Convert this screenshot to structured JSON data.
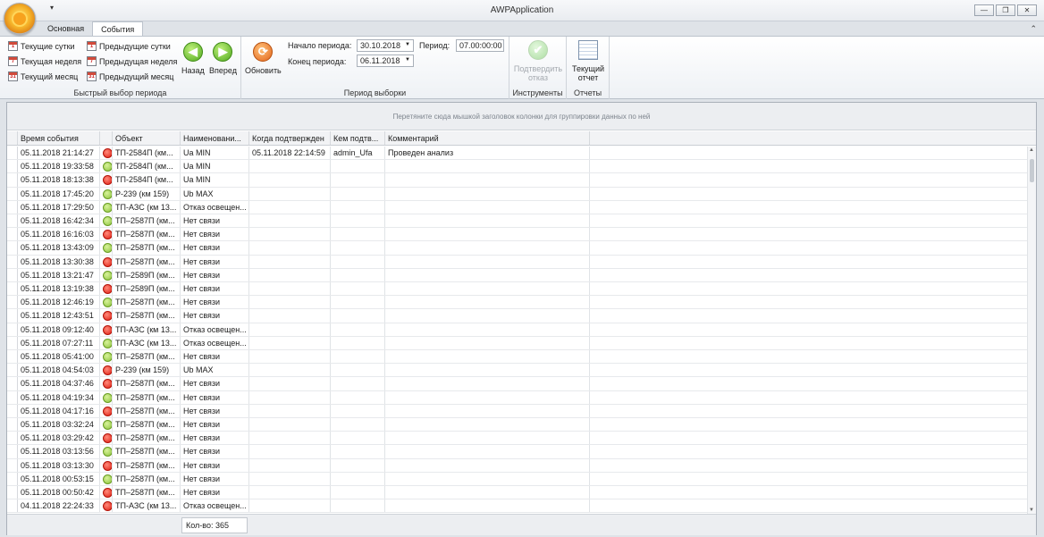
{
  "window": {
    "title": "AWPApplication",
    "qat_arrow": "▾",
    "btn_minimize": "—",
    "btn_restore": "❐",
    "btn_close": "✕",
    "collapse": "⌃"
  },
  "tabs": [
    "Основная",
    "События"
  ],
  "ribbon": {
    "quick_period": {
      "label": "Быстрый выбор периода",
      "items": [
        {
          "label": "Текущие сутки",
          "icon_text": "1"
        },
        {
          "label": "Текущая неделя",
          "icon_text": "7"
        },
        {
          "label": "Текущий месяц",
          "icon_text": "31"
        },
        {
          "label": "Предыдущие сутки",
          "icon_text": "1"
        },
        {
          "label": "Предыдущая неделя",
          "icon_text": "7"
        },
        {
          "label": "Предыдущий месяц",
          "icon_text": "31"
        }
      ],
      "back": "Назад",
      "forward": "Вперед",
      "back_glyph": "◀",
      "forward_glyph": "▶"
    },
    "period": {
      "label": "Период выборки",
      "refresh": "Обновить",
      "refresh_glyph": "⟳",
      "start_label": "Начало периода:",
      "start_value": "30.10.2018",
      "end_label": "Конец периода:",
      "end_value": "06.11.2018",
      "period_label": "Период:",
      "period_value": "07.00:00:00",
      "dd_glyph": "▼"
    },
    "tools": {
      "label": "Инструменты",
      "confirm_line1": "Подтвердить",
      "confirm_line2": "отказ",
      "confirm_glyph": "✔"
    },
    "reports": {
      "label": "Отчеты",
      "current_line1": "Текущий",
      "current_line2": "отчет"
    }
  },
  "grid": {
    "group_hint": "Перетяните сюда мышкой заголовок колонки для группировки данных по ней",
    "columns": [
      "Время события",
      "Объект",
      "Наименовани...",
      "Когда подтвержден",
      "Кем подтв...",
      "Комментарий"
    ],
    "rows": [
      {
        "time": "05.11.2018 21:14:27",
        "status": "red",
        "object": "ТП-2584П (км...",
        "name": "Ua MIN",
        "confirmed_at": "05.11.2018 22:14:59",
        "confirmed_by": "admin_Ufa",
        "comment": "Проведен анализ"
      },
      {
        "time": "05.11.2018 19:33:58",
        "status": "green",
        "object": "ТП-2584П (км...",
        "name": "Ua MIN",
        "confirmed_at": "",
        "confirmed_by": "",
        "comment": ""
      },
      {
        "time": "05.11.2018 18:13:38",
        "status": "red",
        "object": "ТП-2584П (км...",
        "name": "Ua MIN",
        "confirmed_at": "",
        "confirmed_by": "",
        "comment": ""
      },
      {
        "time": "05.11.2018 17:45:20",
        "status": "green",
        "object": "Р-239 (км 159)",
        "name": "Ub MAX",
        "confirmed_at": "",
        "confirmed_by": "",
        "comment": ""
      },
      {
        "time": "05.11.2018 17:29:50",
        "status": "green",
        "object": "ТП-АЗС (км 13...",
        "name": "Отказ освещен...",
        "confirmed_at": "",
        "confirmed_by": "",
        "comment": ""
      },
      {
        "time": "05.11.2018 16:42:34",
        "status": "green",
        "object": "ТП–2587П (км...",
        "name": "Нет связи",
        "confirmed_at": "",
        "confirmed_by": "",
        "comment": ""
      },
      {
        "time": "05.11.2018 16:16:03",
        "status": "red",
        "object": "ТП–2587П (км...",
        "name": "Нет связи",
        "confirmed_at": "",
        "confirmed_by": "",
        "comment": ""
      },
      {
        "time": "05.11.2018 13:43:09",
        "status": "green",
        "object": "ТП–2587П (км...",
        "name": "Нет связи",
        "confirmed_at": "",
        "confirmed_by": "",
        "comment": ""
      },
      {
        "time": "05.11.2018 13:30:38",
        "status": "red",
        "object": "ТП–2587П (км...",
        "name": "Нет связи",
        "confirmed_at": "",
        "confirmed_by": "",
        "comment": ""
      },
      {
        "time": "05.11.2018 13:21:47",
        "status": "green",
        "object": "ТП–2589П (км...",
        "name": "Нет связи",
        "confirmed_at": "",
        "confirmed_by": "",
        "comment": ""
      },
      {
        "time": "05.11.2018 13:19:38",
        "status": "red",
        "object": "ТП–2589П (км...",
        "name": "Нет связи",
        "confirmed_at": "",
        "confirmed_by": "",
        "comment": ""
      },
      {
        "time": "05.11.2018 12:46:19",
        "status": "green",
        "object": "ТП–2587П (км...",
        "name": "Нет связи",
        "confirmed_at": "",
        "confirmed_by": "",
        "comment": ""
      },
      {
        "time": "05.11.2018 12:43:51",
        "status": "red",
        "object": "ТП–2587П (км...",
        "name": "Нет связи",
        "confirmed_at": "",
        "confirmed_by": "",
        "comment": ""
      },
      {
        "time": "05.11.2018 09:12:40",
        "status": "red",
        "object": "ТП-АЗС (км 13...",
        "name": "Отказ освещен...",
        "confirmed_at": "",
        "confirmed_by": "",
        "comment": ""
      },
      {
        "time": "05.11.2018 07:27:11",
        "status": "green",
        "object": "ТП-АЗС (км 13...",
        "name": "Отказ освещен...",
        "confirmed_at": "",
        "confirmed_by": "",
        "comment": ""
      },
      {
        "time": "05.11.2018 05:41:00",
        "status": "green",
        "object": "ТП–2587П (км...",
        "name": "Нет связи",
        "confirmed_at": "",
        "confirmed_by": "",
        "comment": ""
      },
      {
        "time": "05.11.2018 04:54:03",
        "status": "red",
        "object": "Р-239 (км 159)",
        "name": "Ub MAX",
        "confirmed_at": "",
        "confirmed_by": "",
        "comment": ""
      },
      {
        "time": "05.11.2018 04:37:46",
        "status": "red",
        "object": "ТП–2587П (км...",
        "name": "Нет связи",
        "confirmed_at": "",
        "confirmed_by": "",
        "comment": ""
      },
      {
        "time": "05.11.2018 04:19:34",
        "status": "green",
        "object": "ТП–2587П (км...",
        "name": "Нет связи",
        "confirmed_at": "",
        "confirmed_by": "",
        "comment": ""
      },
      {
        "time": "05.11.2018 04:17:16",
        "status": "red",
        "object": "ТП–2587П (км...",
        "name": "Нет связи",
        "confirmed_at": "",
        "confirmed_by": "",
        "comment": ""
      },
      {
        "time": "05.11.2018 03:32:24",
        "status": "green",
        "object": "ТП–2587П (км...",
        "name": "Нет связи",
        "confirmed_at": "",
        "confirmed_by": "",
        "comment": ""
      },
      {
        "time": "05.11.2018 03:29:42",
        "status": "red",
        "object": "ТП–2587П (км...",
        "name": "Нет связи",
        "confirmed_at": "",
        "confirmed_by": "",
        "comment": ""
      },
      {
        "time": "05.11.2018 03:13:56",
        "status": "green",
        "object": "ТП–2587П (км...",
        "name": "Нет связи",
        "confirmed_at": "",
        "confirmed_by": "",
        "comment": ""
      },
      {
        "time": "05.11.2018 03:13:30",
        "status": "red",
        "object": "ТП–2587П (км...",
        "name": "Нет связи",
        "confirmed_at": "",
        "confirmed_by": "",
        "comment": ""
      },
      {
        "time": "05.11.2018 00:53:15",
        "status": "green",
        "object": "ТП–2587П (км...",
        "name": "Нет связи",
        "confirmed_at": "",
        "confirmed_by": "",
        "comment": ""
      },
      {
        "time": "05.11.2018 00:50:42",
        "status": "red",
        "object": "ТП–2587П (км...",
        "name": "Нет связи",
        "confirmed_at": "",
        "confirmed_by": "",
        "comment": ""
      },
      {
        "time": "04.11.2018 22:24:33",
        "status": "red",
        "object": "ТП-АЗС (км 13...",
        "name": "Отказ освещен...",
        "confirmed_at": "",
        "confirmed_by": "",
        "comment": ""
      }
    ],
    "count_label": "Кол-во: 365",
    "scroll_up": "▲",
    "scroll_down": "▼"
  },
  "colors": {
    "status_red": "#e01e12",
    "status_green": "#8cc43c",
    "ribbon_bg": "#f3f5f8"
  }
}
